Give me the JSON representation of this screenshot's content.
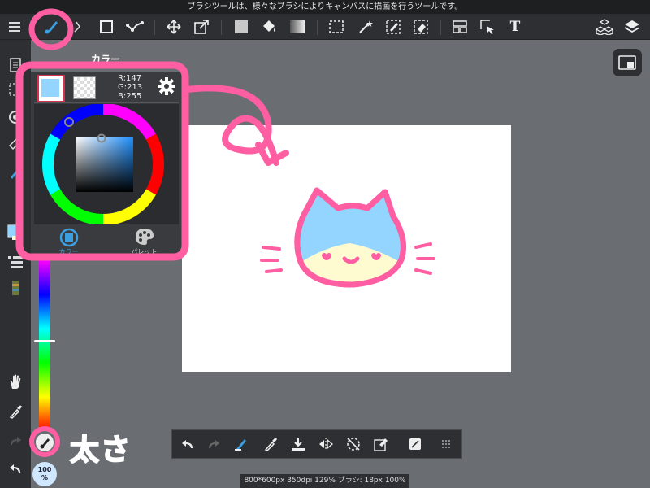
{
  "tip_text": "ブラシツールは、様々なブラシによりキャンバスに描画を行うツールです。",
  "toolbar": {
    "left": [
      "menu-icon",
      "brush-icon",
      "eraser-icon",
      "rect-shape-icon",
      "polyline-icon"
    ],
    "text_tool_label": "T"
  },
  "color_panel": {
    "title": "カラー",
    "r": "R:147",
    "g": "G:213",
    "b": "B:255",
    "main_color": "#93d5ff",
    "sub_color": "#fffbd0",
    "tabs": [
      {
        "label": "カラー",
        "icon": "color-wheel-icon",
        "active": true
      },
      {
        "label": "パレット",
        "icon": "palette-icon",
        "active": false
      }
    ]
  },
  "opacity": {
    "value": "100",
    "unit": "%"
  },
  "status_bar": "800*600px 350dpi 129% ブラシ: 18px 100%",
  "annotation": {
    "label": "太さ",
    "color": "#ff5fa2"
  },
  "colors": {
    "accent": "#3aa0e0",
    "annotation": "#ff5fa2",
    "hue_knob": "#ffffff"
  }
}
